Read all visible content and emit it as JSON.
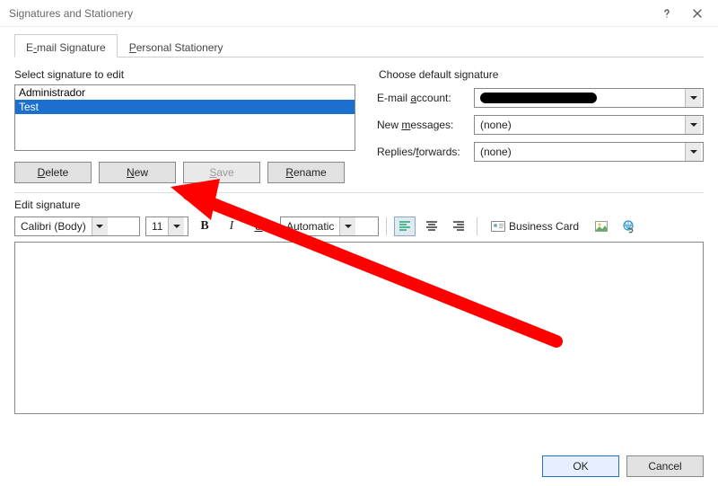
{
  "window_title": "Signatures and Stationery",
  "tabs": [
    {
      "label_pre": "E",
      "label_acc": "-",
      "label_post": "mail Signature",
      "active": true
    },
    {
      "label_pre": "",
      "label_acc": "P",
      "label_post": "ersonal Stationery",
      "active": false
    }
  ],
  "left": {
    "select_label_pre": "Sele",
    "select_label_acc": "c",
    "select_label_post": "t signature to edit",
    "signatures": [
      {
        "name": "Administrador",
        "selected": false
      },
      {
        "name": "Test",
        "selected": true
      }
    ],
    "buttons": {
      "delete_pre": "",
      "delete_acc": "D",
      "delete_post": "elete",
      "new_pre": "",
      "new_acc": "N",
      "new_post": "ew",
      "save_pre": "",
      "save_acc": "S",
      "save_post": "ave",
      "rename_pre": "",
      "rename_acc": "R",
      "rename_post": "ename"
    }
  },
  "right": {
    "title": "Choose default signature",
    "account_label_pre": "E-mail ",
    "account_label_acc": "a",
    "account_label_post": "ccount:",
    "account_value": "",
    "new_msg_label_pre": "New ",
    "new_msg_label_acc": "m",
    "new_msg_label_post": "essages:",
    "new_msg_value": "(none)",
    "replies_label_pre": "Replies/",
    "replies_label_acc": "f",
    "replies_label_post": "orwards:",
    "replies_value": "(none)"
  },
  "edit": {
    "label_pre": "Edi",
    "label_acc": "t",
    "label_post": " signature",
    "font": "Calibri (Body)",
    "size": "11",
    "color_label": "Automatic",
    "biz_label_pre": "",
    "biz_label_acc": "B",
    "biz_label_post": "usiness Card"
  },
  "footer": {
    "ok": "OK",
    "cancel": "Cancel"
  }
}
